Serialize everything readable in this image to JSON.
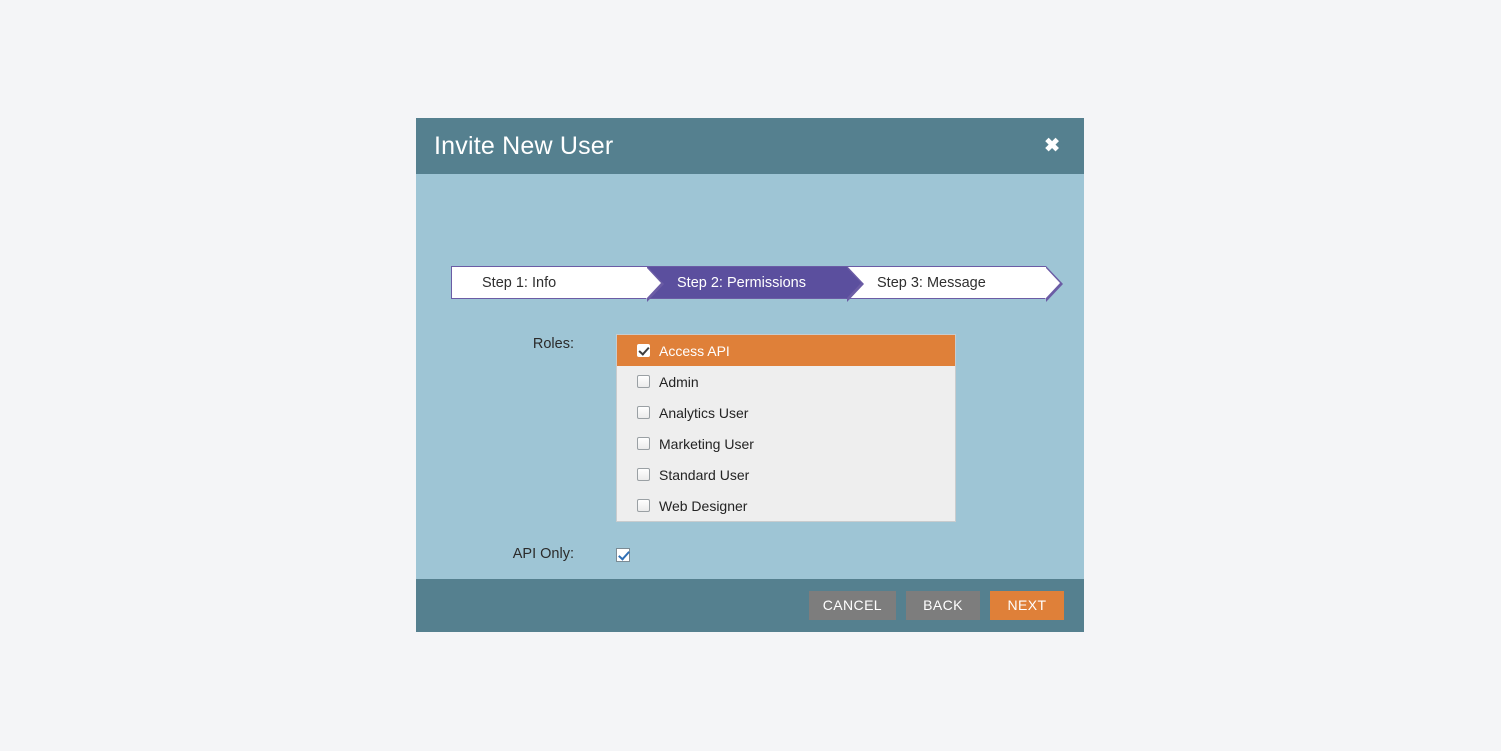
{
  "modal": {
    "title": "Invite New User",
    "close_icon": "close-icon",
    "close_glyph": "✖"
  },
  "steps": [
    {
      "label": "Step 1: Info",
      "active": false
    },
    {
      "label": "Step 2: Permissions",
      "active": true
    },
    {
      "label": "Step 3: Message",
      "active": false
    }
  ],
  "fields": {
    "roles_label": "Roles:",
    "api_only_label": "API Only:",
    "api_only_checked": true
  },
  "roles": [
    {
      "label": "Access API",
      "checked": true,
      "selected": true
    },
    {
      "label": "Admin",
      "checked": false,
      "selected": false
    },
    {
      "label": "Analytics User",
      "checked": false,
      "selected": false
    },
    {
      "label": "Marketing User",
      "checked": false,
      "selected": false
    },
    {
      "label": "Standard User",
      "checked": false,
      "selected": false
    },
    {
      "label": "Web Designer",
      "checked": false,
      "selected": false
    }
  ],
  "footer": {
    "cancel_label": "CANCEL",
    "back_label": "BACK",
    "next_label": "NEXT"
  },
  "colors": {
    "page_bg": "#f4f5f7",
    "modal_bg": "#9ec5d5",
    "header_bg": "#55808f",
    "footer_bg": "#55808f",
    "accent_orange": "#df8039",
    "step_active": "#5b4f9e",
    "step_border": "#6b5ca5",
    "list_bg": "#eeeeee",
    "btn_grey": "#7d7d7d"
  }
}
